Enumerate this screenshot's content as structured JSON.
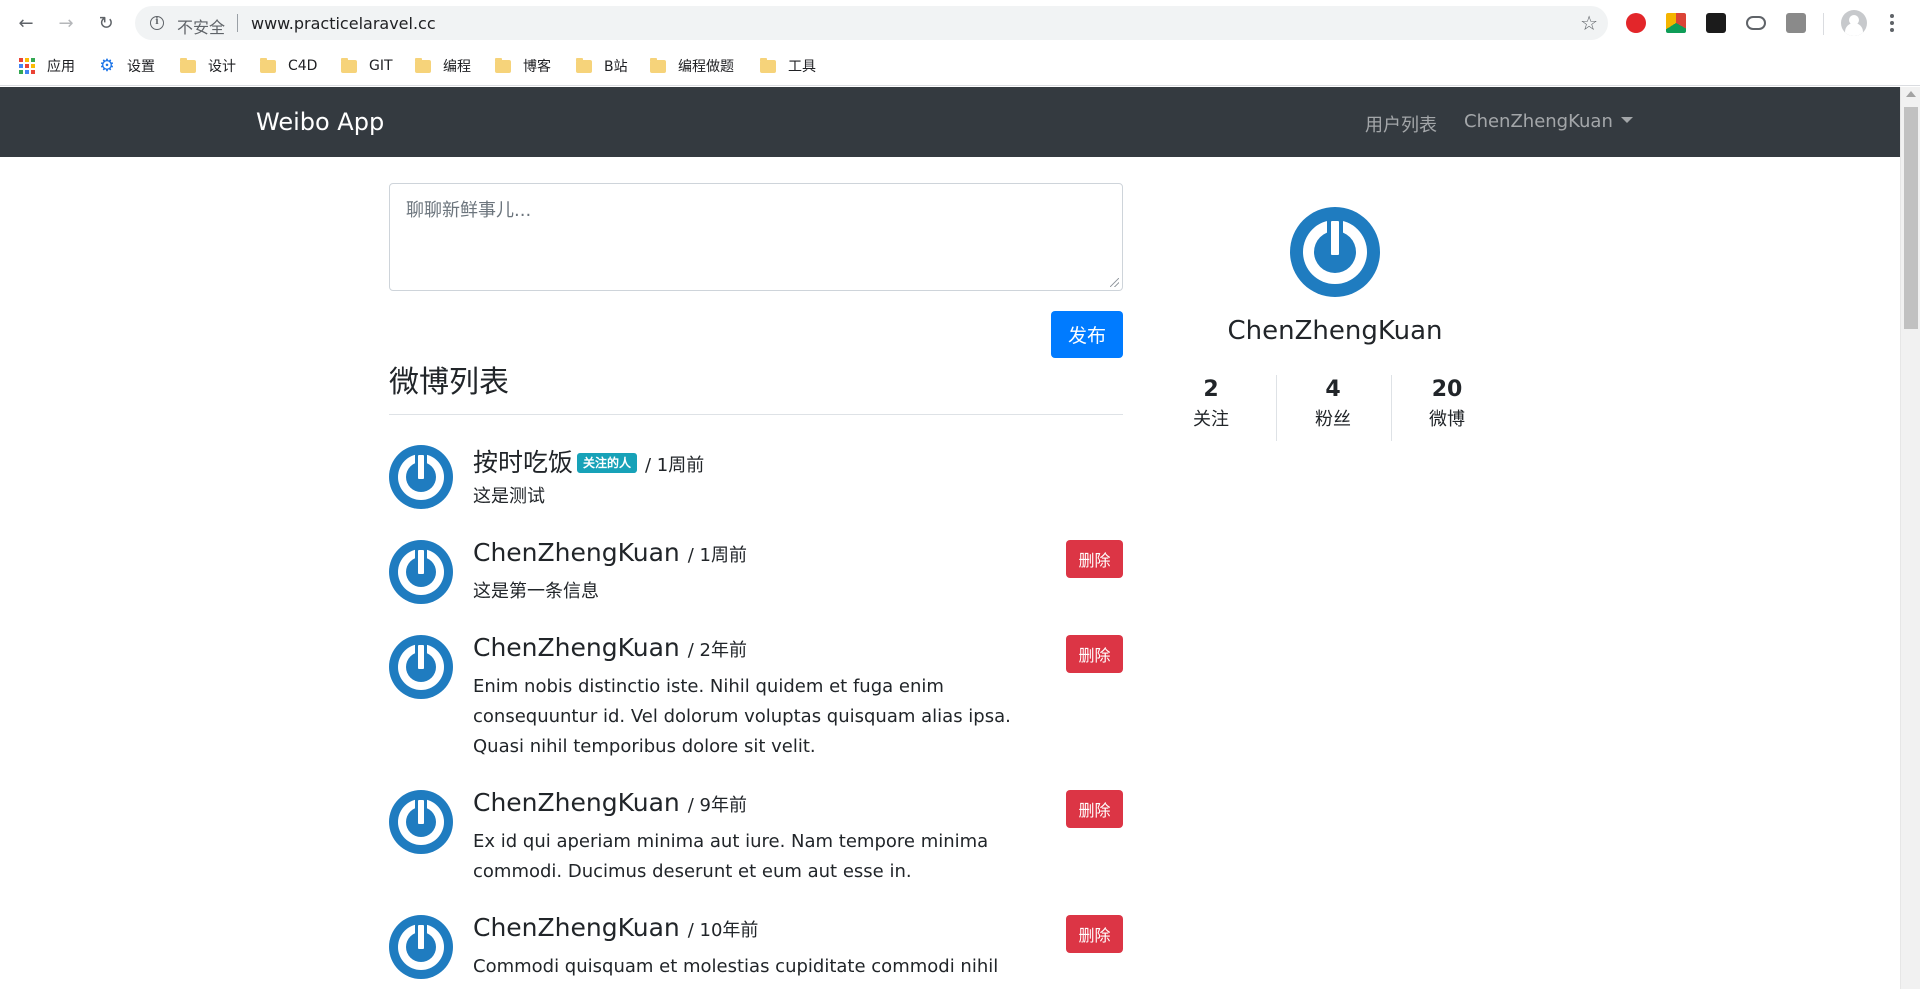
{
  "browser": {
    "insecure_label": "不安全",
    "url": "www.practicelaravel.cc",
    "bookmarks": [
      {
        "label": "应用",
        "icon": "apps-grid-icon"
      },
      {
        "label": "设置",
        "icon": "gear-icon"
      },
      {
        "label": "设计",
        "icon": "folder-icon"
      },
      {
        "label": "C4D",
        "icon": "folder-icon"
      },
      {
        "label": "GIT",
        "icon": "folder-icon"
      },
      {
        "label": "编程",
        "icon": "folder-icon"
      },
      {
        "label": "博客",
        "icon": "folder-icon"
      },
      {
        "label": "B站",
        "icon": "folder-icon"
      },
      {
        "label": "编程做题",
        "icon": "folder-icon"
      },
      {
        "label": "工具",
        "icon": "folder-icon"
      }
    ]
  },
  "navbar": {
    "brand": "Weibo App",
    "users_link": "用户列表",
    "user_menu": "ChenZhengKuan"
  },
  "composer": {
    "placeholder": "聊聊新鲜事儿...",
    "submit_label": "发布"
  },
  "feed": {
    "title": "微博列表",
    "delete_label": "删除",
    "items": [
      {
        "name": "按时吃饭",
        "badge": "关注的人",
        "meta": "/ 1周前",
        "body": "这是测试"
      },
      {
        "name": "ChenZhengKuan",
        "meta": "/ 1周前",
        "body": "这是第一条信息"
      },
      {
        "name": "ChenZhengKuan",
        "meta": "/ 2年前",
        "body": "Enim nobis distinctio iste. Nihil quidem et fuga enim consequuntur id. Vel dolorum voluptas quisquam alias ipsa. Quasi nihil temporibus dolore sit velit."
      },
      {
        "name": "ChenZhengKuan",
        "meta": "/ 9年前",
        "body": "Ex id qui aperiam minima aut iure. Nam tempore minima commodi. Ducimus deserunt et eum aut esse in."
      },
      {
        "name": "ChenZhengKuan",
        "meta": "/ 10年前",
        "body": "Commodi quisquam et molestias cupiditate commodi nihil rerum."
      }
    ]
  },
  "profile": {
    "name": "ChenZhengKuan",
    "stats": [
      {
        "value": "2",
        "label": "关注"
      },
      {
        "value": "4",
        "label": "粉丝"
      },
      {
        "value": "20",
        "label": "微博"
      }
    ]
  },
  "colors": {
    "navbar_bg": "#343a40",
    "primary": "#007bff",
    "danger": "#dc3545",
    "badge_info": "#17a2b8",
    "avatar_blue": "#1f7cc0"
  }
}
